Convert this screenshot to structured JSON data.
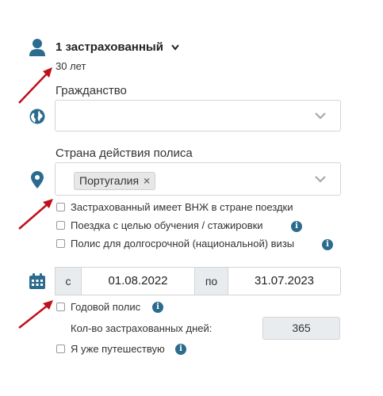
{
  "insured": {
    "title": "1 застрахованный",
    "age": "30 лет"
  },
  "citizenship": {
    "label": "Гражданство",
    "value": ""
  },
  "policy_country": {
    "label": "Страна действия полиса",
    "selected_tag": "Португалия",
    "tag_remove": "×"
  },
  "checkboxes": {
    "residence_permit": "Застрахованный имеет ВНЖ в стране поездки",
    "study_trip": "Поездка с целью обучения / стажировки",
    "long_term_visa": "Полис для долгосрочной (национальной) визы"
  },
  "dates": {
    "from_label": "с",
    "from_value": "01.08.2022",
    "to_label": "по",
    "to_value": "31.07.2023"
  },
  "annual": {
    "label": "Годовой полис"
  },
  "days": {
    "label": "Кол-во застрахованных дней:",
    "value": "365"
  },
  "already_travelling": {
    "label": "Я уже путешествую"
  },
  "info_glyph": "i",
  "colors": {
    "icon": "#2b6c8e",
    "arrow": "#c0101a",
    "field_border": "#d4d4d4"
  }
}
